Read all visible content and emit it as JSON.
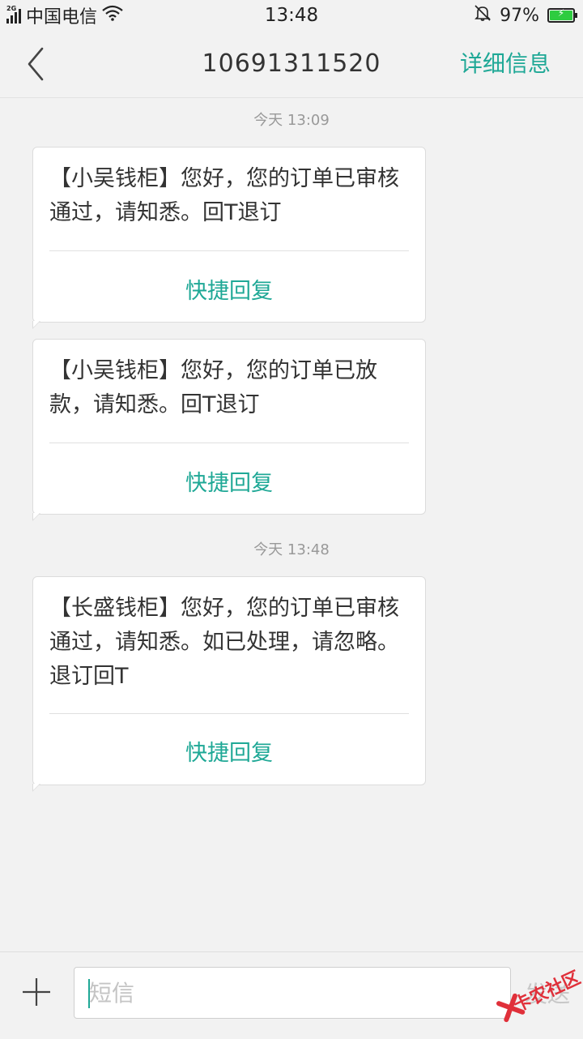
{
  "status_bar": {
    "network_type": "2G",
    "carrier": "中国电信",
    "time": "13:48",
    "battery": "97%",
    "battery_level": 0.97,
    "colors": {
      "battery": "#2ecc40"
    }
  },
  "header": {
    "back_icon": "chevron-left-icon",
    "title": "10691311520",
    "detail_label": "详细信息"
  },
  "messages": [
    {
      "type": "timestamp",
      "text": "今天  13:09"
    },
    {
      "type": "message",
      "text": "【小吴钱柜】您好，您的订单已审核通过，请知悉。回T退订",
      "action": "快捷回复"
    },
    {
      "type": "message",
      "text": "【小吴钱柜】您好，您的订单已放款，请知悉。回T退订",
      "action": "快捷回复"
    },
    {
      "type": "timestamp",
      "text": "今天  13:48"
    },
    {
      "type": "message",
      "text": "【长盛钱柜】您好，您的订单已审核通过，请知悉。如已处理，请忽略。退订回T",
      "action": "快捷回复"
    }
  ],
  "composer": {
    "add_icon": "plus-icon",
    "placeholder": "短信",
    "value": "",
    "send_label": "发送"
  },
  "watermark": {
    "text": "卡农社区"
  },
  "colors": {
    "accent": "#1fa896",
    "background": "#f2f2f2"
  }
}
